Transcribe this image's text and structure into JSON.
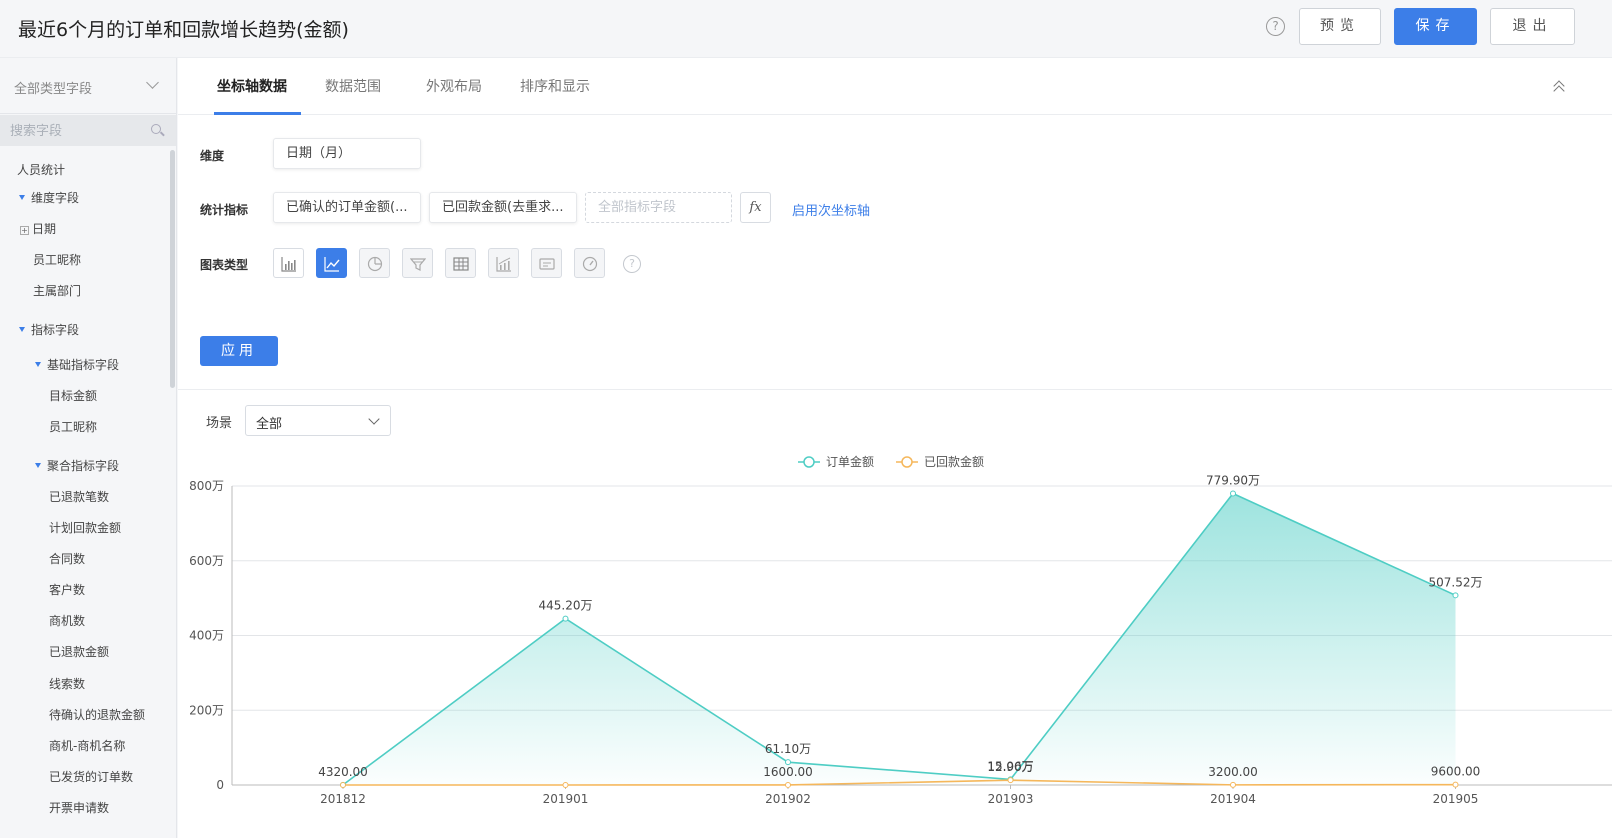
{
  "header": {
    "title": "最近6个月的订单和回款增长趋势(金额)",
    "help": "?",
    "preview_label": "预览",
    "save_label": "保存",
    "exit_label": "退出"
  },
  "sidebar": {
    "field_type": "全部类型字段",
    "search_placeholder": "搜索字段",
    "items": [
      {
        "label": "人员统计"
      },
      {
        "label": "维度字段"
      },
      {
        "label": "日期"
      },
      {
        "label": "员工昵称"
      },
      {
        "label": "主属部门"
      },
      {
        "label": "指标字段"
      },
      {
        "label": "基础指标字段"
      },
      {
        "label": "目标金额"
      },
      {
        "label": "员工昵称"
      },
      {
        "label": "聚合指标字段"
      },
      {
        "label": "已退款笔数"
      },
      {
        "label": "计划回款金额"
      },
      {
        "label": "合同数"
      },
      {
        "label": "客户数"
      },
      {
        "label": "商机数"
      },
      {
        "label": "已退款金额"
      },
      {
        "label": "线索数"
      },
      {
        "label": "待确认的退款金额"
      },
      {
        "label": "商机-商机名称"
      },
      {
        "label": "已发货的订单数"
      },
      {
        "label": "开票申请数"
      }
    ]
  },
  "tabs": [
    {
      "label": "坐标轴数据"
    },
    {
      "label": "数据范围"
    },
    {
      "label": "外观布局"
    },
    {
      "label": "排序和显示"
    }
  ],
  "config": {
    "dimension_label": "维度",
    "dimension_value": "日期（月）",
    "metrics_label": "统计指标",
    "metric_1": "已确认的订单金额(...",
    "metric_2": "已回款金额(去重求...",
    "metric_placeholder": "全部指标字段",
    "fx": "fx",
    "secondary_axis": "启用次坐标轴",
    "chart_type_label": "图表类型",
    "chart_types": [
      "bar-chart-icon",
      "line-chart-icon",
      "pie-chart-icon",
      "funnel-chart-icon",
      "table-icon",
      "bar-line-combo-icon",
      "card-icon",
      "gauge-icon"
    ],
    "active_chart_type": "line-chart-icon",
    "help": "?",
    "apply_label": "应用"
  },
  "scene": {
    "label": "场景",
    "value": "全部"
  },
  "colors": {
    "accent": "#3c7ee8",
    "series_order": "#4ecdc4",
    "series_received": "#f5b75b"
  },
  "chart_data": {
    "type": "line",
    "categories": [
      "201812",
      "201901",
      "201902",
      "201903",
      "201904",
      "201905"
    ],
    "ylim": [
      0,
      800
    ],
    "yticks": [
      "0",
      "200万",
      "400万",
      "600万",
      "800万"
    ],
    "legend_position": "top-center",
    "grid": true,
    "series": [
      {
        "name": "订单金额",
        "values": [
          0.432,
          445.2,
          61.1,
          15.06,
          779.9,
          507.52
        ],
        "labels": [
          "4320.00",
          "445.20万",
          "61.10万",
          "15.06万",
          "779.90万",
          "507.52万"
        ],
        "area": true
      },
      {
        "name": "已回款金额",
        "values": [
          0,
          0,
          0.16,
          12.9,
          0.32,
          0.96
        ],
        "labels": [
          "",
          "",
          "1600.00",
          "12.90万",
          "3200.00",
          "9600.00"
        ],
        "area": false
      }
    ]
  }
}
